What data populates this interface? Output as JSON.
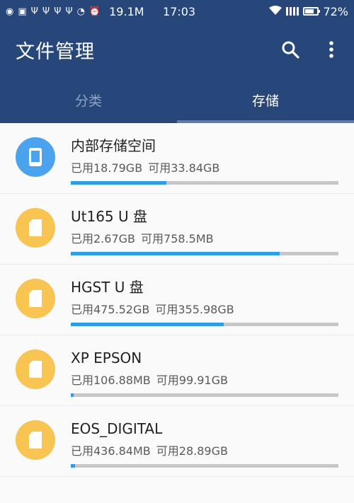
{
  "status_bar": {
    "speed": "19.1M",
    "time": "17:03",
    "battery": "72%",
    "battery_level": 0.72
  },
  "app": {
    "title": "文件管理",
    "icons": [
      "search-icon",
      "more-vert-icon"
    ]
  },
  "tabs": [
    {
      "label": "分类",
      "active": false
    },
    {
      "label": "存储",
      "active": true
    }
  ],
  "storage": [
    {
      "name": "内部存储空间",
      "used": "已用18.79GB",
      "free": "可用33.84GB",
      "usage_fraction": 0.357,
      "icon": "phone-icon",
      "color": "#4aa3ec"
    },
    {
      "name": "Ut165 U 盘",
      "used": "已用2.67GB",
      "free": "可用758.5MB",
      "usage_fraction": 0.78,
      "icon": "sd-card-icon",
      "color": "#f8c452"
    },
    {
      "name": "HGST U 盘",
      "used": "已用475.52GB",
      "free": "可用355.98GB",
      "usage_fraction": 0.572,
      "icon": "sd-card-icon",
      "color": "#f8c452"
    },
    {
      "name": "XP EPSON",
      "used": "已用106.88MB",
      "free": "可用99.91GB",
      "usage_fraction": 0.001,
      "icon": "sd-card-icon",
      "color": "#f8c452"
    },
    {
      "name": "EOS_DIGITAL",
      "used": "已用436.84MB",
      "free": "可用28.89GB",
      "usage_fraction": 0.015,
      "icon": "sd-card-icon",
      "color": "#f8c452"
    }
  ]
}
